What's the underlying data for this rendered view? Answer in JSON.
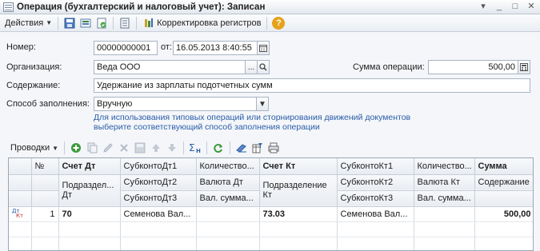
{
  "window": {
    "title": "Операция (бухгалтерский и налоговый учет): Записан"
  },
  "toolbar": {
    "actions_label": "Действия",
    "registers_label": "Корректировка регистров",
    "help_label": "?"
  },
  "form": {
    "number_label": "Номер:",
    "number_value": "00000000001",
    "date_label": "от:",
    "date_value": "16.05.2013  8:40:55",
    "org_label": "Организация:",
    "org_value": "Веда ООО",
    "sum_label": "Сумма операции:",
    "sum_value": "500,00",
    "content_label": "Содержание:",
    "content_value": "Удержание из зарплаты подотчетных сумм",
    "fill_label": "Способ заполнения:",
    "fill_value": "Вручную",
    "hint_line1": "Для использования типовых операций или сторнирования движений документов",
    "hint_line2": "выберите соответствующий способ заполнения операции"
  },
  "grid_toolbar": {
    "entries_label": "Проводки"
  },
  "grid": {
    "header_row1": [
      "",
      "№",
      "Счет Дт",
      "СубконтоДт1",
      "Количество...",
      "Счет Кт",
      "СубконтоКт1",
      "Количество...",
      "Сумма"
    ],
    "header_row2": [
      "",
      "",
      "Подраздел... Дт",
      "СубконтоДт2",
      "Валюта Дт",
      "Подразделение Кт",
      "СубконтоКт2",
      "Валюта Кт",
      "Содержание"
    ],
    "header_row3": [
      "",
      "",
      "",
      "СубконтоДт3",
      "Вал. сумма...",
      "",
      "СубконтоКт3",
      "Вал. сумма...",
      ""
    ],
    "rows": [
      {
        "icon": "dt-kt-icon",
        "num": "1",
        "acc_dt": "70",
        "subdt1": "Семенова Вал...",
        "qty_dt": "",
        "acc_kt": "73.03",
        "subkt1": "Семенова Вал...",
        "qty_kt": "",
        "sum": "500,00"
      }
    ]
  }
}
